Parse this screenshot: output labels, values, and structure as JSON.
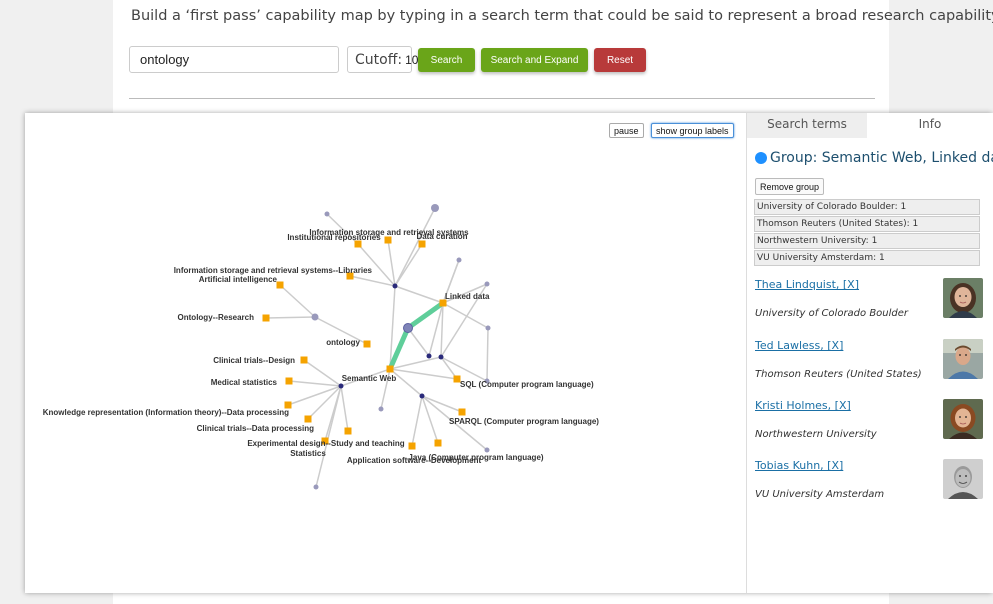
{
  "header": {
    "intro_text": "Build a ‘first pass’ capability map by typing in a search term that could be said to represent a broad research capability."
  },
  "search": {
    "value": "ontology",
    "cutoff_label": "Cutoff:",
    "cutoff_value": "10"
  },
  "buttons": {
    "search": "Search",
    "search_expand": "Search and Expand",
    "reset": "Reset"
  },
  "graph_controls": {
    "pause": "pause",
    "show_group_labels": "show group labels"
  },
  "graph": {
    "labels": {
      "info_storage": "Information storage and retrieval systems",
      "institutional_repos": "Institutional repositories",
      "data_curation": "Data curation",
      "info_storage_libraries": "Information storage and retrieval systems--Libraries",
      "artificial_intelligence": "Artificial intelligence",
      "linked_data": "Linked data",
      "ontology_research": "Ontology--Research",
      "ontology": "ontology",
      "clinical_trials_design": "Clinical trials--Design",
      "semantic_web": "Semantic Web",
      "medical_statistics": "Medical statistics",
      "sql": "SQL (Computer program language)",
      "knowledge_rep": "Knowledge representation (Information theory)--Data processing",
      "sparql": "SPARQL (Computer program language)",
      "clinical_trials_data": "Clinical trials--Data processing",
      "experimental_design": "Experimental design--Study and teaching",
      "statistics": "Statistics",
      "java": "Java (Computer program language)",
      "app_software": "Application software--Development"
    }
  },
  "info_panel": {
    "tabs": [
      "Search terms",
      "Info"
    ],
    "active_tab": "Info",
    "group_title": "Group: Semantic Web, Linked data",
    "group_color": "#1e90ff",
    "remove_group": "Remove group",
    "institutions": [
      "University of Colorado Boulder: 1",
      "Thomson Reuters (United States): 1",
      "Northwestern University: 1",
      "VU University Amsterdam: 1"
    ],
    "people": [
      {
        "name": "Thea Lindquist, [X]",
        "institution": "University of Colorado Boulder"
      },
      {
        "name": "Ted Lawless, [X]",
        "institution": "Thomson Reuters (United States)"
      },
      {
        "name": "Kristi Holmes, [X]",
        "institution": "Northwestern University"
      },
      {
        "name": "Tobias Kuhn, [X]",
        "institution": "VU University Amsterdam"
      }
    ]
  },
  "colors": {
    "button_green": "#6aa519",
    "button_red": "#b83a3a",
    "term_node": "#f5a300",
    "hub_node": "#2a2a7a",
    "person_node": "#9999bb",
    "highlight_edge": "#5fce9a",
    "link": "#1a6fa5"
  }
}
